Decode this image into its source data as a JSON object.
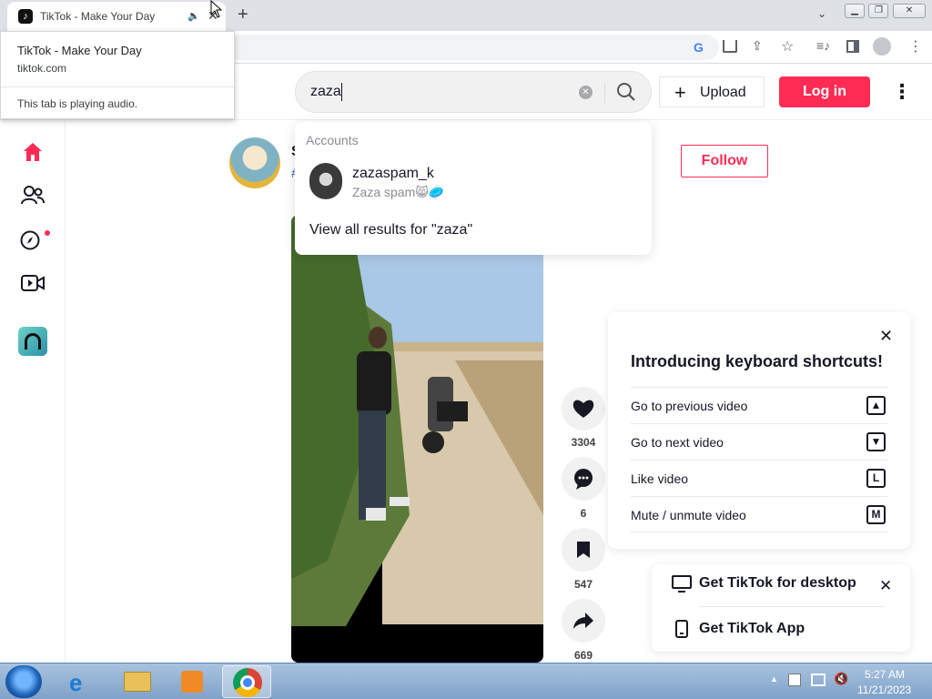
{
  "browser": {
    "tab_title": "TikTok - Make Your Day",
    "hovercard": {
      "title": "TikTok - Make Your Day",
      "domain": "tiktok.com",
      "status": "This tab is playing audio."
    }
  },
  "header": {
    "search_value": "zaza",
    "upload_label": "Upload",
    "login_label": "Log in"
  },
  "dropdown": {
    "section_title": "Accounts",
    "account_name": "zazaspam_k",
    "account_subtitle": "Zaza spam😸🥏",
    "view_all": "View all results for \"zaza\""
  },
  "feed": {
    "follow_label": "Follow",
    "likes": "3304",
    "comments": "6",
    "saves": "547",
    "shares": "669"
  },
  "shortcuts": {
    "title": "Introducing keyboard shortcuts!",
    "rows": [
      {
        "label": "Go to previous video",
        "key": "▲"
      },
      {
        "label": "Go to next video",
        "key": "▼"
      },
      {
        "label": "Like video",
        "key": "L"
      },
      {
        "label": "Mute / unmute video",
        "key": "M"
      }
    ]
  },
  "getapp": {
    "desktop_label": "Get TikTok for desktop",
    "app_label": "Get TikTok App"
  },
  "taskbar": {
    "time": "5:27 AM",
    "date": "11/21/2023"
  },
  "colors": {
    "brand": "#fe2c55",
    "text": "#161823"
  }
}
